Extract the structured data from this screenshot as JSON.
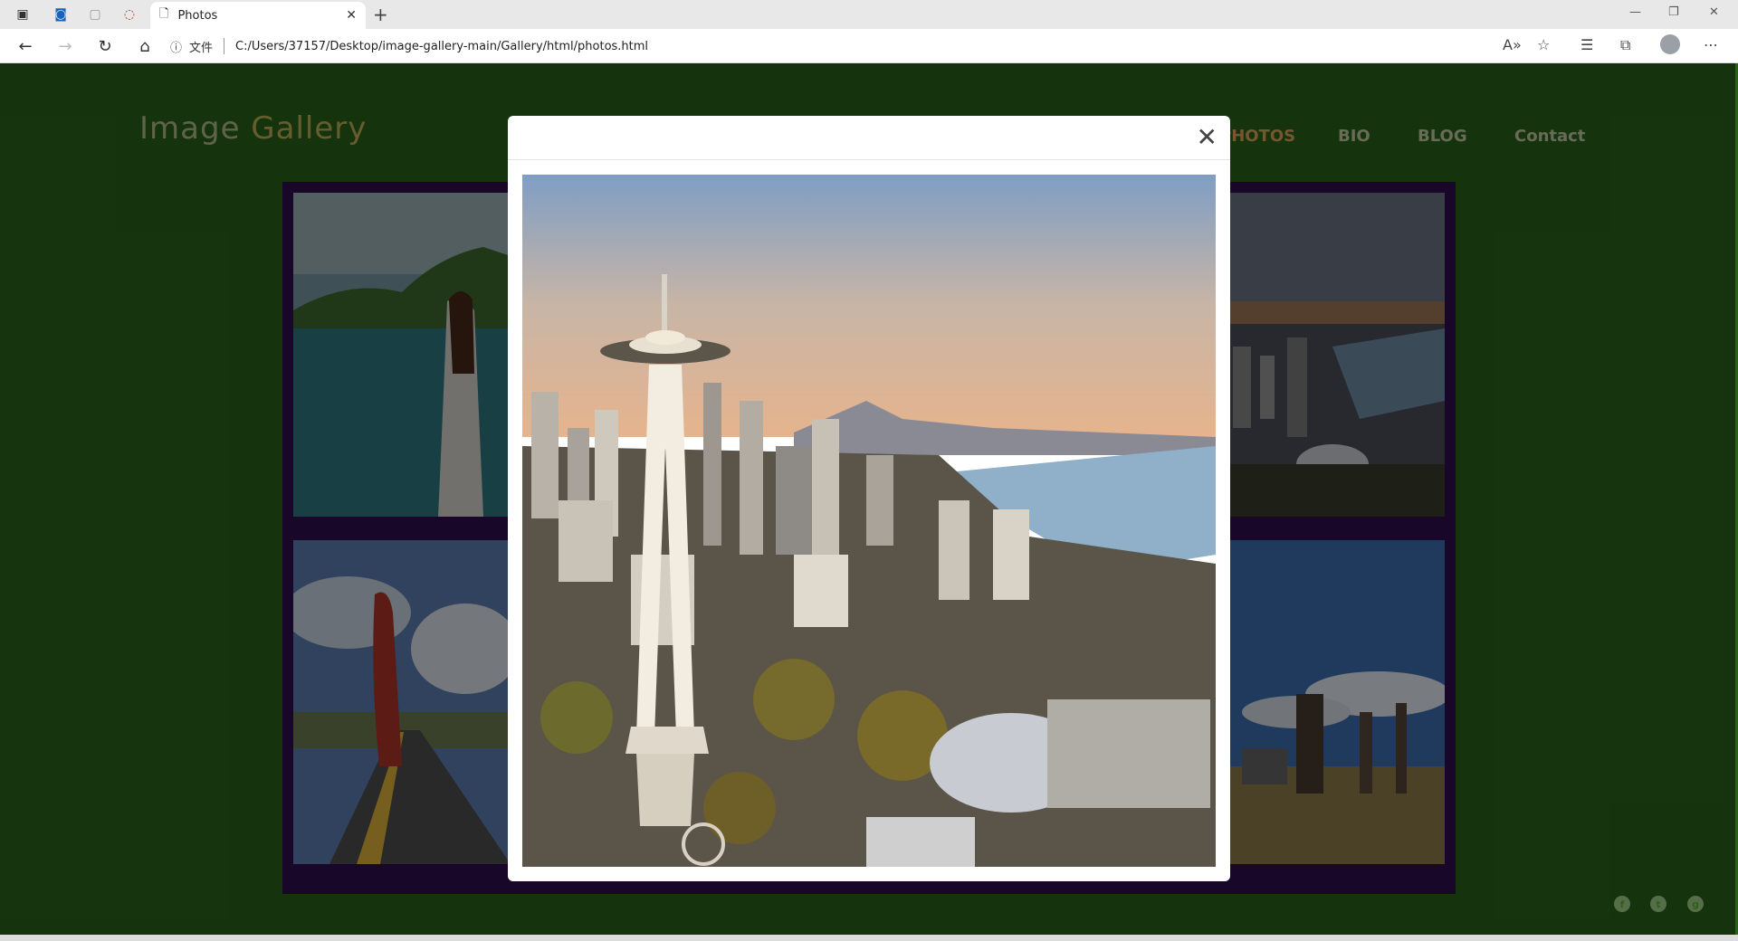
{
  "browser": {
    "tab_title": "Photos",
    "address_prefix": "文件",
    "url": "C:/Users/37157/Desktop/image-gallery-main/Gallery/html/photos.html"
  },
  "site": {
    "logo_part1": "Image",
    "logo_part2": "Gallery",
    "nav": [
      {
        "label": "PHOTOS",
        "active": true
      },
      {
        "label": "BIO",
        "active": false
      },
      {
        "label": "BLOG",
        "active": false
      },
      {
        "label": "Contact",
        "active": false
      }
    ]
  },
  "gallery": {
    "photos": [
      {
        "name": "girl-by-the-sea"
      },
      {
        "name": "city-skyline-aerial"
      },
      {
        "name": "woman-on-road"
      },
      {
        "name": "industrial-park"
      }
    ]
  },
  "modal": {
    "image_name": "seattle-space-needle-aerial",
    "close_symbol": "✕"
  },
  "footer": {
    "social": [
      {
        "icon": "facebook-icon",
        "glyph": "f"
      },
      {
        "icon": "twitter-icon",
        "glyph": "t"
      },
      {
        "icon": "github-icon",
        "glyph": "g"
      }
    ]
  },
  "colors": {
    "page_bg": "#2a6318",
    "gallery_frame": "#2f0f4e",
    "nav_active": "#e0a55a"
  }
}
